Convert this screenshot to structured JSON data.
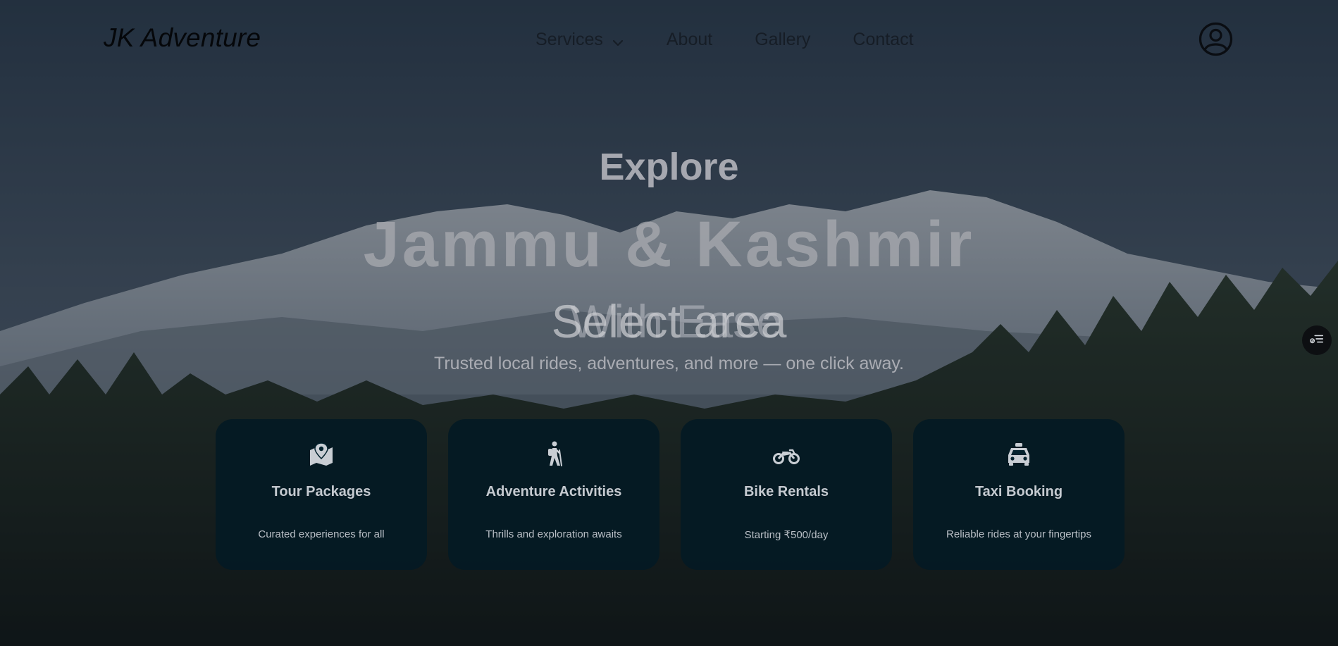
{
  "header": {
    "logo": "JK Adventure",
    "nav": [
      {
        "label": "Services",
        "has_dropdown": true
      },
      {
        "label": "About"
      },
      {
        "label": "Gallery"
      },
      {
        "label": "Contact"
      }
    ],
    "profile_icon": "user-circle-icon"
  },
  "hero": {
    "eyebrow": "Explore",
    "title": "Jammu & Kashmir",
    "subtitle": "With Ease",
    "overlay_text": "Select area",
    "tagline": "Trusted local rides, adventures, and more — one click away."
  },
  "cards": [
    {
      "icon": "map-pin-icon",
      "title": "Tour Packages",
      "desc": "Curated experiences for all"
    },
    {
      "icon": "hiker-icon",
      "title": "Adventure Activities",
      "desc": "Thrills and exploration awaits"
    },
    {
      "icon": "motorcycle-icon",
      "title": "Bike Rentals",
      "desc": "Starting ₹500/day"
    },
    {
      "icon": "taxi-icon",
      "title": "Taxi Booking",
      "desc": "Reliable rides at your fingertips"
    }
  ],
  "side_button_icon": "filter-list-icon",
  "colors": {
    "card_bg": "#04222e",
    "sky": "#2b3a4a",
    "forest": "#1a2416"
  }
}
